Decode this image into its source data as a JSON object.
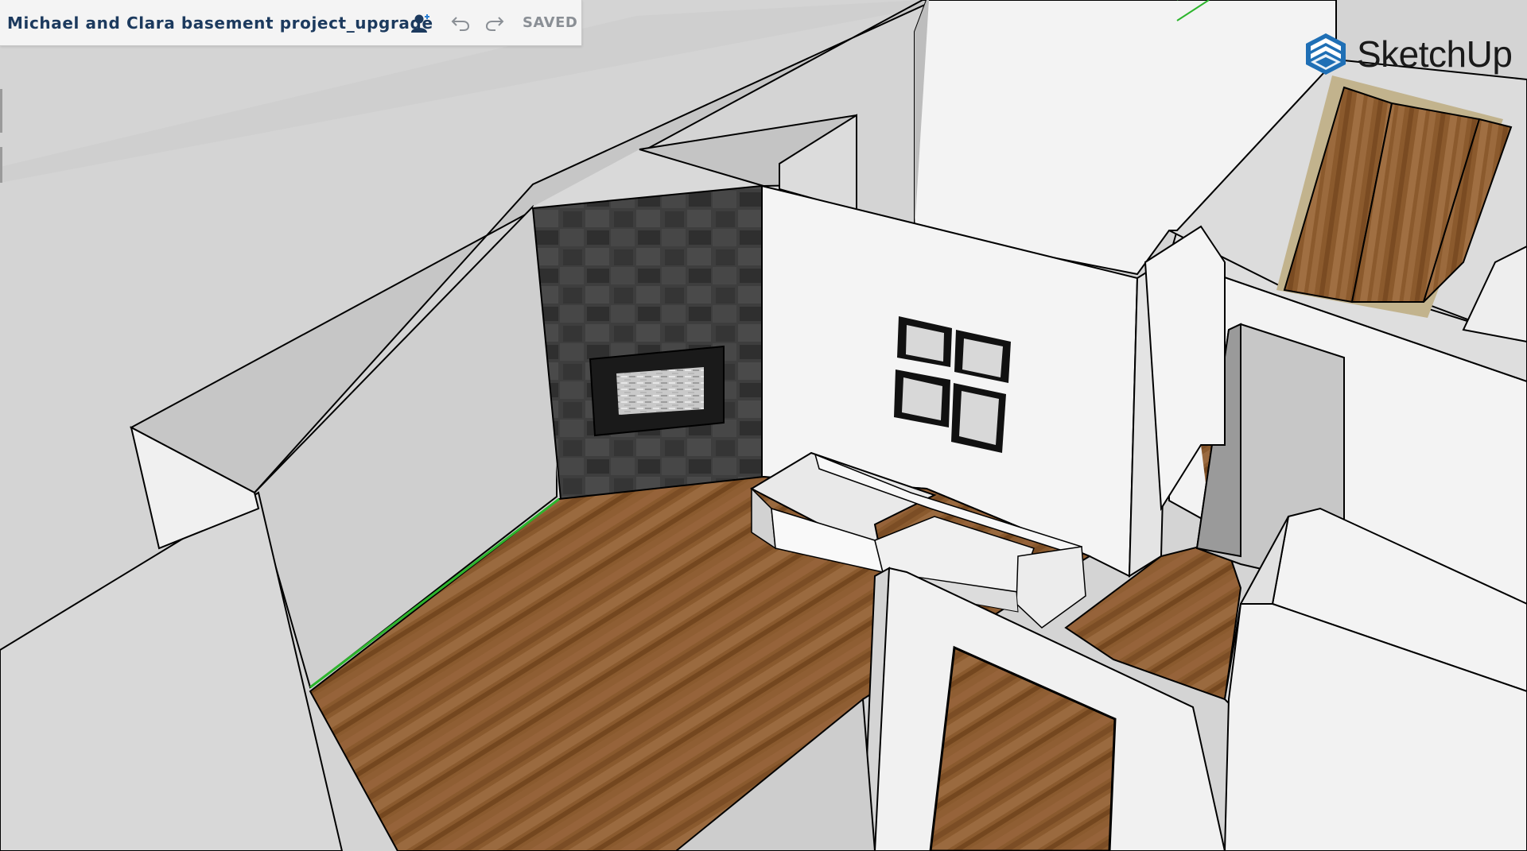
{
  "app": {
    "name": "SketchUp",
    "document_title": "Michael and Clara basement project_upgrade",
    "save_status": "SAVED"
  },
  "toolbar": {
    "collaborator_icon": "add-user-icon",
    "undo_icon": "undo-icon",
    "redo_icon": "redo-icon"
  },
  "colors": {
    "brand_blue": "#1f6fb5",
    "title_navy": "#1c3a5e",
    "saved_gray": "#8a8f95",
    "axis_green": "#2db52d"
  },
  "scene": {
    "view": "3D perspective",
    "objects": [
      "walls",
      "wood floor",
      "stone fireplace wall",
      "sofa",
      "framed wall art",
      "doors"
    ]
  }
}
